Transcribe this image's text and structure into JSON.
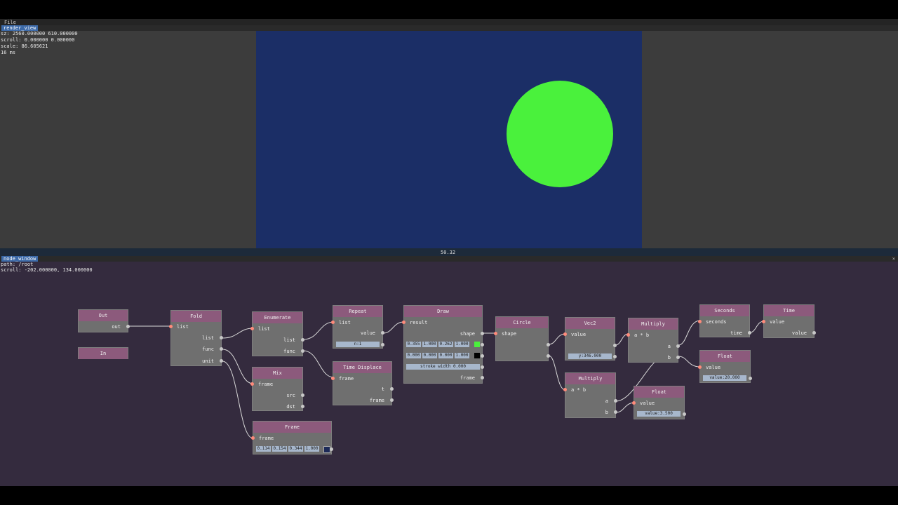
{
  "menu": {
    "file_label": "File"
  },
  "render_window": {
    "title": "render_view",
    "info_lines": [
      "sz: 2560.000000 610.000000",
      "scroll: 0.000000 0.000000",
      "scale: 86.605621",
      "16 ms"
    ],
    "canvas_color": "#1b2e66",
    "circle_color": "#4af13c"
  },
  "splitter": {
    "label": "50.32"
  },
  "node_window": {
    "title": "node_window",
    "path": "path: /root",
    "scroll": "scroll: -202.000000, 134.000000",
    "close": "×"
  },
  "nodes": {
    "out": {
      "title": "Out",
      "out_port": "out"
    },
    "in": {
      "title": "In"
    },
    "fold": {
      "title": "Fold",
      "in_list": "list",
      "out_list": "list",
      "func": "func",
      "unit": "unit"
    },
    "enumerate": {
      "title": "Enumerate",
      "in_list": "list",
      "out_list": "list",
      "func": "func"
    },
    "repeat": {
      "title": "Repeat",
      "in_list": "list",
      "value": "value",
      "field": "n:1"
    },
    "time_displace": {
      "title": "Time Displace",
      "frame": "frame",
      "t": "t",
      "frame_out": "frame"
    },
    "draw": {
      "title": "Draw",
      "result": "result",
      "shape": "shape",
      "color1": [
        "0.355",
        "1.000",
        "0.262",
        "1.000"
      ],
      "color1_swatch": "#4af13c",
      "color2": [
        "0.000",
        "0.000",
        "0.000",
        "1.000"
      ],
      "color2_swatch": "#000000",
      "stroke": "stroke width 0.000",
      "frame": "frame"
    },
    "circle": {
      "title": "Circle",
      "shape": "shape"
    },
    "vec2": {
      "title": "Vec2",
      "value": "value",
      "field": "y:346.000"
    },
    "multiply1": {
      "title": "Multiply",
      "axb": "a * b",
      "a": "a",
      "b": "b"
    },
    "seconds": {
      "title": "Seconds",
      "seconds": "seconds",
      "time": "time"
    },
    "time": {
      "title": "Time",
      "value_in": "value",
      "value_out": "value"
    },
    "float1": {
      "title": "Float",
      "value": "value",
      "field": "value:20.000"
    },
    "multiply2": {
      "title": "Multiply",
      "axb": "a * b",
      "a": "a",
      "b": "b"
    },
    "float2": {
      "title": "Float",
      "value": "value",
      "field": "value:3.500"
    },
    "mix": {
      "title": "Mix",
      "frame": "frame",
      "src": "src",
      "dst": "dst"
    },
    "frame": {
      "title": "Frame",
      "frame": "frame",
      "values": [
        "0.114",
        "0.154",
        "0.344",
        "1.000"
      ],
      "swatch": "#1d2a58"
    }
  }
}
